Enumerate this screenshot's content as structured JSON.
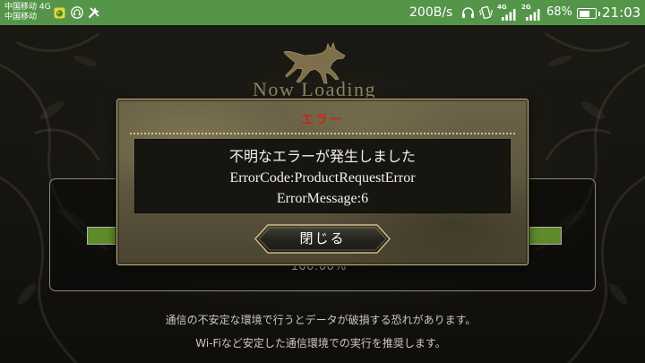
{
  "status_bar": {
    "carrier_line1": "中国移动 4G",
    "carrier_line2": "中国移动",
    "notification_icons": [
      "app-notification-icon",
      "headset-icon",
      "tools-icon"
    ],
    "net_speed": "200B/s",
    "status_icons": [
      "headphones-icon",
      "vibrate-icon",
      "signal-icon",
      "battery-icon"
    ],
    "signal_1_label": "4G",
    "signal_2_label": "2G",
    "battery_text": "68%",
    "battery_level": 0.68,
    "time": "21:03",
    "background_color": "#55954a"
  },
  "loading": {
    "logo_icon": "wolf-logo-icon",
    "title": "Now Loading",
    "progress": 1.0,
    "progress_text": "100.00%",
    "progress_color": "#5d8b2a"
  },
  "error_dialog": {
    "title": "エラー",
    "title_color": "#c8281e",
    "message_lines": [
      "不明なエラーが発生しました",
      "ErrorCode:ProductRequestError",
      "ErrorMessage:6"
    ],
    "close_button_label": "閉じる"
  },
  "notice": {
    "lines": [
      "通信の不安定な環境で行うとデータが破損する恐れがあります。",
      "Wi-Fiなど安定した通信環境での実行を推奨します。"
    ]
  }
}
